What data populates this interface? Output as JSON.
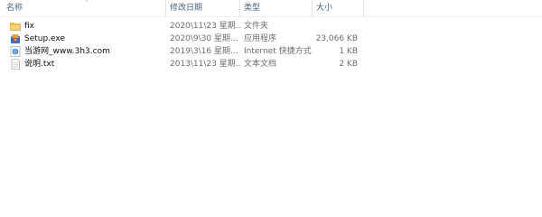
{
  "columns": {
    "name": "名称",
    "date": "修改日期",
    "type": "类型",
    "size": "大小"
  },
  "files": [
    {
      "name": "fix",
      "date": "2020\\11\\23 星期...",
      "type": "文件夹",
      "size": "",
      "icon": "folder-icon"
    },
    {
      "name": "Setup.exe",
      "date": "2020\\9\\30 星期...",
      "type": "应用程序",
      "size": "23,066 KB",
      "icon": "setup-exe-icon"
    },
    {
      "name": "当游网_www.3h3.com",
      "date": "2019\\3\\16 星期...",
      "type": "Internet 快捷方式",
      "size": "1 KB",
      "icon": "internet-shortcut-icon"
    },
    {
      "name": "说明.txt",
      "date": "2013\\11\\23 星期...",
      "type": "文本文档",
      "size": "2 KB",
      "icon": "text-file-icon"
    }
  ]
}
